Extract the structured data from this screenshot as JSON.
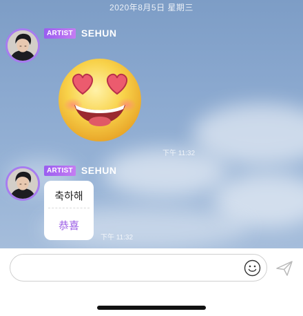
{
  "chat": {
    "date_separator": "2020年8月5日 星期三",
    "messages": [
      {
        "badge": "ARTIST",
        "sender": "SEHUN",
        "sticker_icon": "heart-eyes-emoji",
        "time": "下午 11:32"
      },
      {
        "badge": "ARTIST",
        "sender": "SEHUN",
        "text": "축하해",
        "translation": "恭喜",
        "time": "下午 11:32"
      }
    ]
  },
  "input_bar": {
    "placeholder": "",
    "value": "",
    "emoji_icon": "smiley-icon",
    "send_icon": "send-icon"
  },
  "colors": {
    "artist_badge": "#a96af1",
    "avatar_ring": "#a77cf0",
    "translation_text": "#9b5de5",
    "chat_background": "#8aa8cf"
  }
}
